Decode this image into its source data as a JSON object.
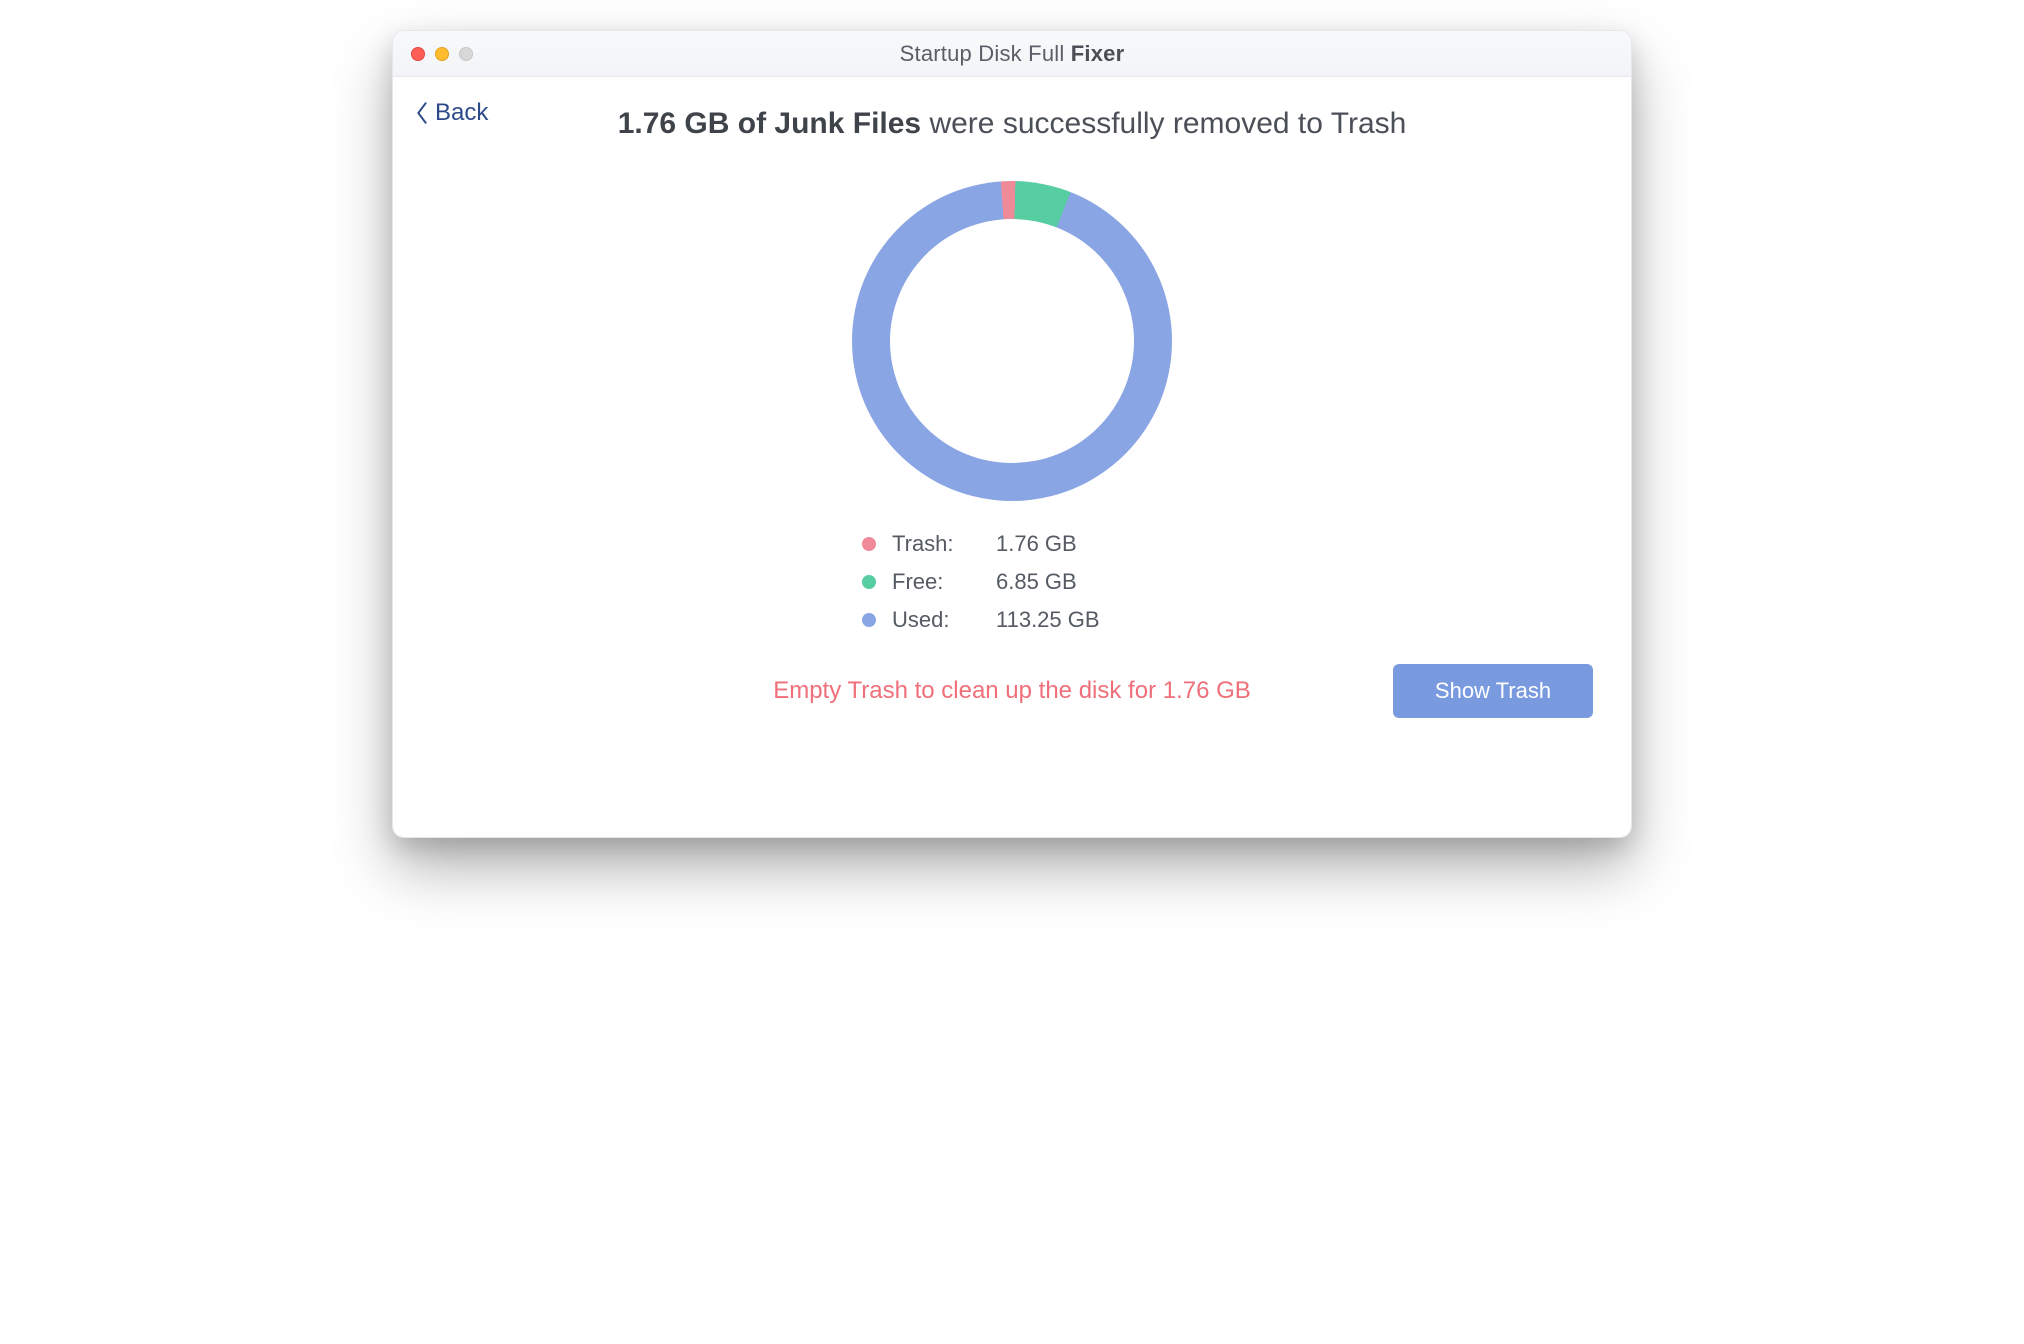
{
  "window": {
    "title_prefix": "Startup Disk Full ",
    "title_bold": "Fixer"
  },
  "back_label": "Back",
  "headline": {
    "strong": "1.76 GB of Junk Files",
    "rest": " were successfully removed to Trash"
  },
  "colors": {
    "trash": "#ef8a98",
    "free": "#57cda2",
    "used": "#8aa5e3"
  },
  "chart_data": {
    "type": "pie",
    "title": "",
    "series": [
      {
        "name": "Trash",
        "value": 1.76,
        "unit": "GB",
        "color": "#ef8a98"
      },
      {
        "name": "Free",
        "value": 6.85,
        "unit": "GB",
        "color": "#57cda2"
      },
      {
        "name": "Used",
        "value": 113.25,
        "unit": "GB",
        "color": "#8aa5e3"
      }
    ],
    "start_angle_deg": -4
  },
  "legend": {
    "items": [
      {
        "label": "Trash:",
        "value": "1.76 GB"
      },
      {
        "label": "Free:",
        "value": "6.85 GB"
      },
      {
        "label": "Used:",
        "value": "113.25 GB"
      }
    ]
  },
  "hint_text": "Empty Trash to clean up the disk for 1.76 GB",
  "show_trash_label": "Show Trash"
}
